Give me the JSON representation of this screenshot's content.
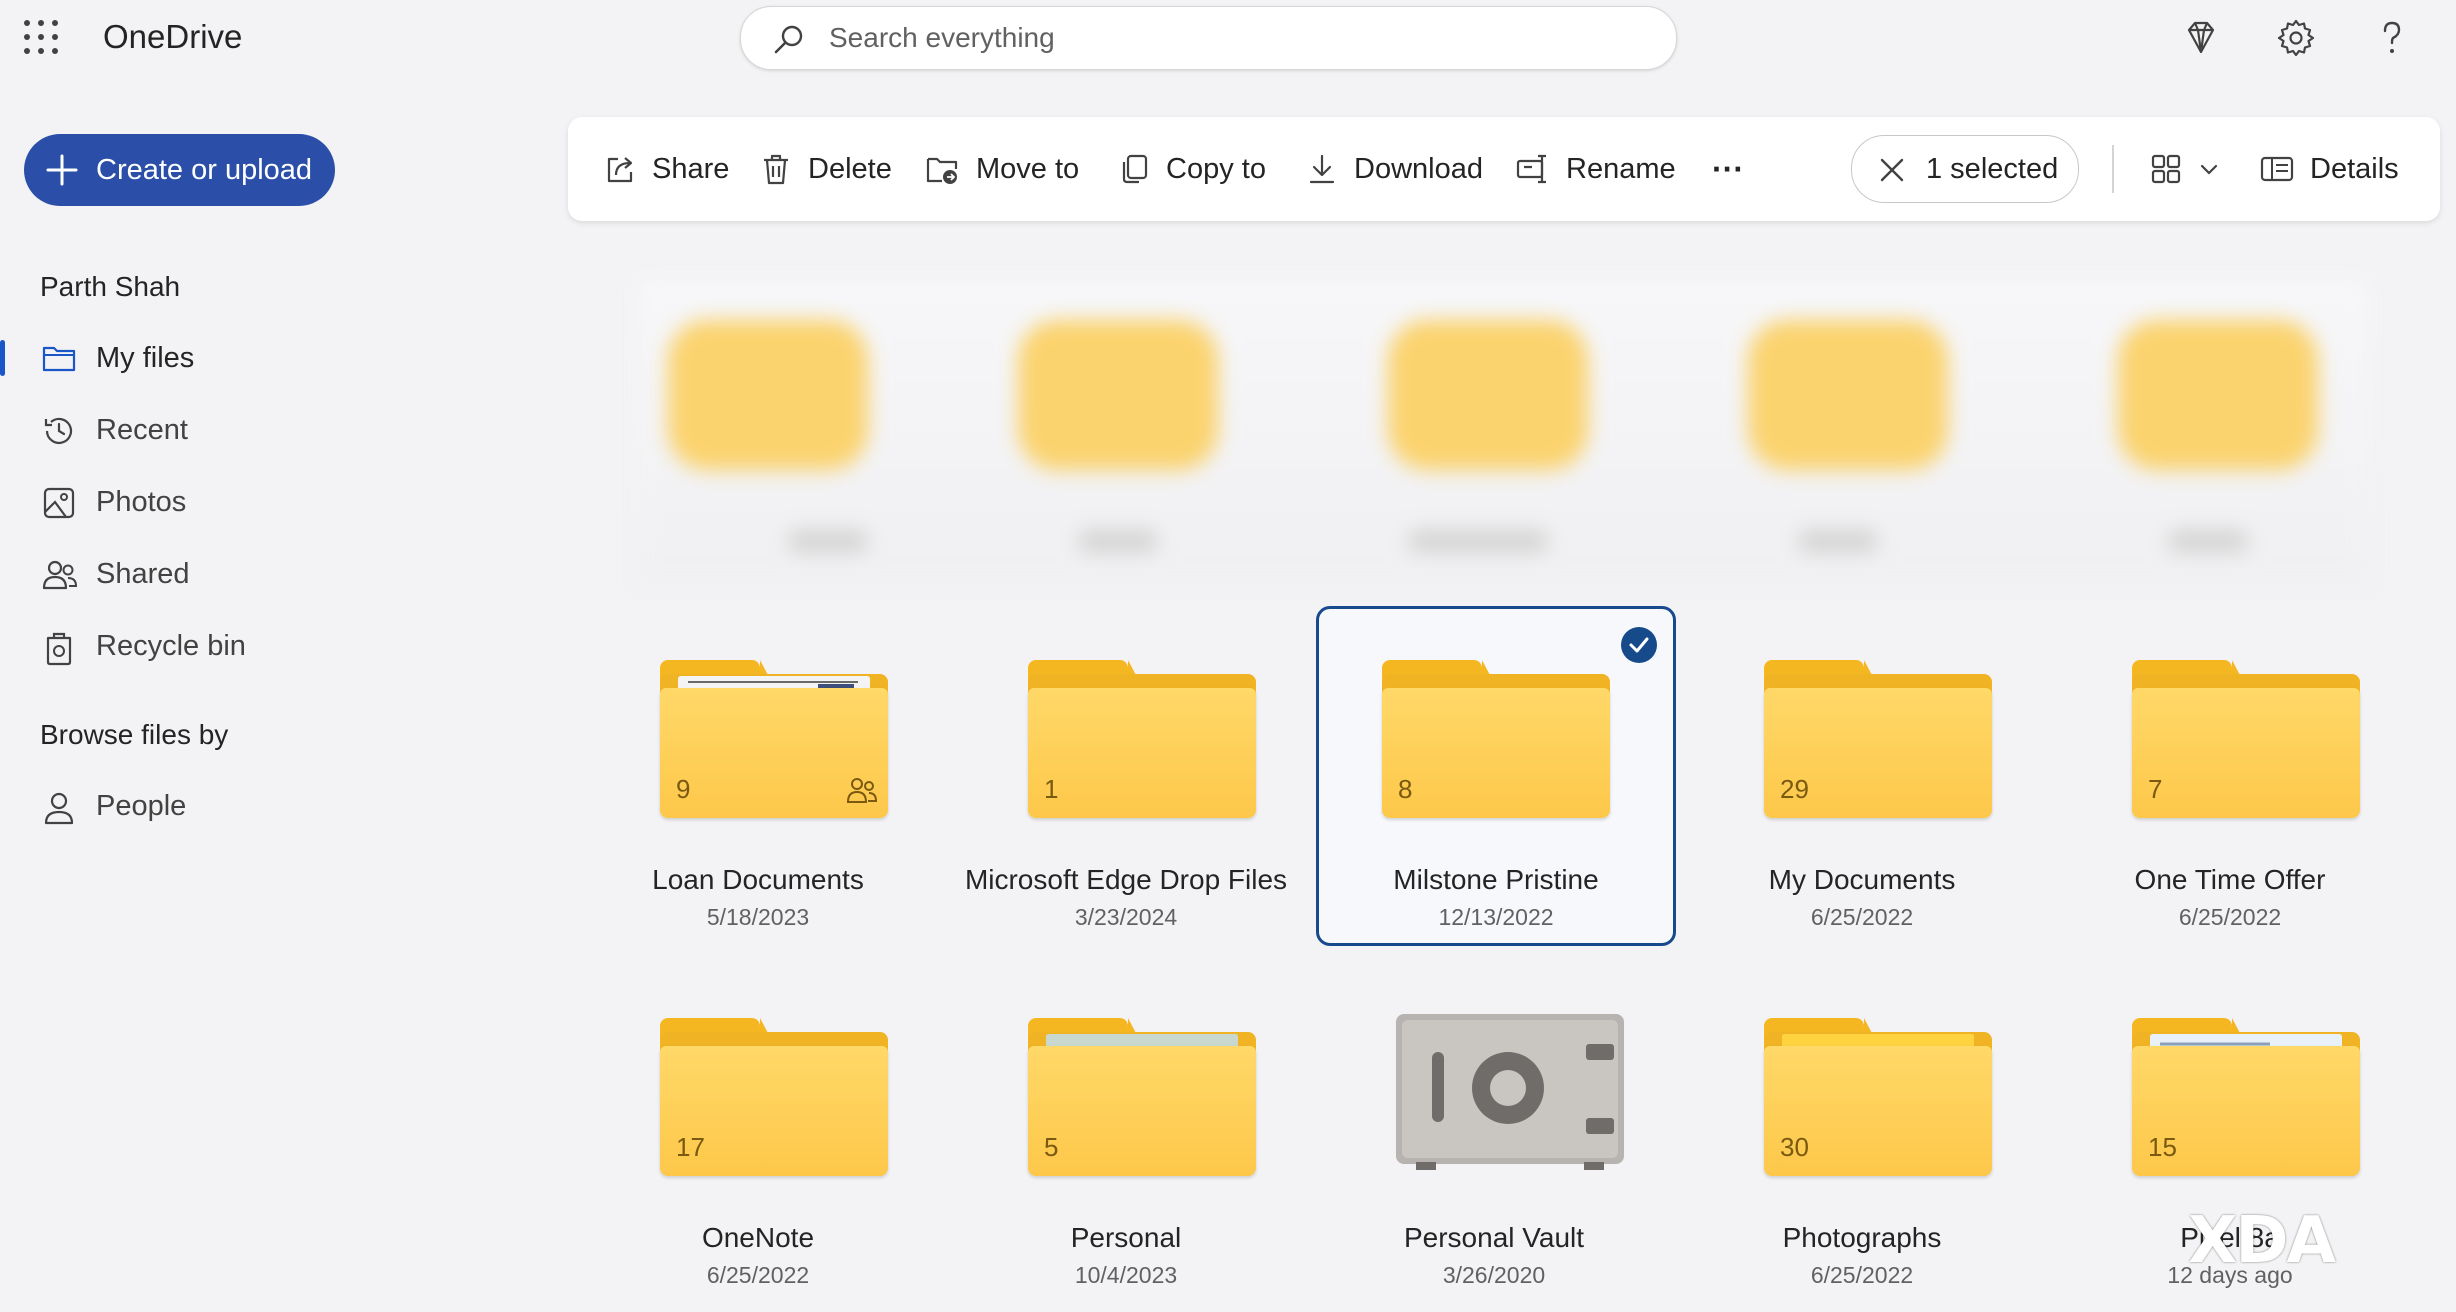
{
  "header": {
    "app_name": "OneDrive",
    "search_placeholder": "Search everything",
    "icons": [
      "waffle-icon",
      "diamond-icon",
      "gear-icon",
      "help-icon"
    ]
  },
  "nav": {
    "create_label": "Create or upload",
    "user": "Parth Shah",
    "items": [
      {
        "label": "My files",
        "icon": "folder-icon",
        "active": true
      },
      {
        "label": "Recent",
        "icon": "history-icon"
      },
      {
        "label": "Photos",
        "icon": "image-icon"
      },
      {
        "label": "Shared",
        "icon": "people-icon"
      },
      {
        "label": "Recycle bin",
        "icon": "recycle-bin-icon"
      }
    ],
    "browse_title": "Browse files by",
    "browse_items": [
      {
        "label": "People",
        "icon": "person-icon"
      }
    ]
  },
  "commands": {
    "share": "Share",
    "delete": "Delete",
    "move_to": "Move to",
    "copy_to": "Copy to",
    "download": "Download",
    "rename": "Rename",
    "more": "···",
    "selected": "1 selected",
    "details": "Details"
  },
  "folders": [
    {
      "name": "Loan Documents",
      "date": "5/18/2023",
      "count": "9",
      "shared": true,
      "thumb": "document"
    },
    {
      "name": "Microsoft Edge Drop Files",
      "date": "3/23/2024",
      "count": "1"
    },
    {
      "name": "Milstone Pristine",
      "date": "12/13/2022",
      "count": "8",
      "selected": true
    },
    {
      "name": "My Documents",
      "date": "6/25/2022",
      "count": "29"
    },
    {
      "name": "One Time Offer",
      "date": "6/25/2022",
      "count": "7"
    },
    {
      "name": "OneNote",
      "date": "6/25/2022",
      "count": "17"
    },
    {
      "name": "Personal",
      "date": "10/4/2023",
      "count": "5",
      "thumb": "id-card"
    },
    {
      "name": "Personal Vault",
      "date": "3/26/2020",
      "type": "vault"
    },
    {
      "name": "Photographs",
      "date": "6/25/2022",
      "count": "30",
      "thumb": "welcome"
    },
    {
      "name": "Pixel 8a",
      "date": "12 days ago",
      "count": "15",
      "thumb": "phone-ui"
    }
  ],
  "watermark": "XDA",
  "colors": {
    "accent": "#2b4fa8",
    "selection": "#174a8b",
    "folder": "#fdc84a"
  }
}
